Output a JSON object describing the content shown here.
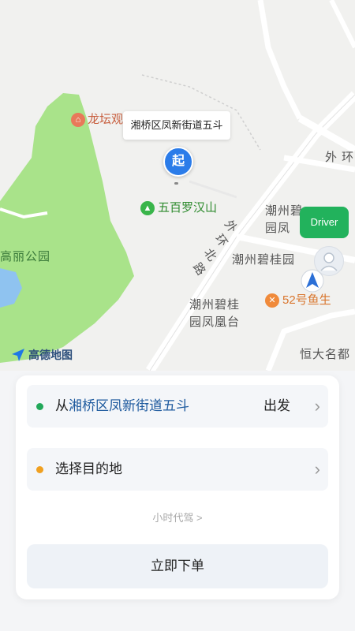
{
  "map": {
    "tooltip": "湘桥区凤新街道五斗",
    "start_pin": "起",
    "driver_label": "Driver",
    "logo_text": "高德地图",
    "labels": {
      "longtan": "龙坛观",
      "wubai": "五百罗汉山",
      "gaoli": "高丽公园",
      "waihuanbei_1": "外",
      "waihuanbei_2": "环",
      "waihuanbei_3": "北",
      "waihuanbei_4": "路",
      "waihuan_top": "外 环",
      "chaozhou_top": "潮州碧",
      "yuanfeng_top": "园凤",
      "chaozhou_biguiyuan": "潮州碧桂园",
      "chaozhou_2_line1": "潮州碧桂",
      "chaozhou_2_line2": "园凤凰台",
      "yusheng": "52号鱼生",
      "hengda": "恒大名都"
    }
  },
  "order": {
    "from_prefix": "从",
    "from_location": "湘桥区凤新街道五斗",
    "depart_label": "出发",
    "destination_placeholder": "选择目的地",
    "hourly_link": "小时代驾 >",
    "submit_label": "立即下单"
  },
  "colors": {
    "park_green": "#a9e38a",
    "start_blue": "#2b7ce9",
    "driver_green": "#22b25c",
    "from_dot": "#22a85a",
    "dest_dot": "#f0a020"
  }
}
